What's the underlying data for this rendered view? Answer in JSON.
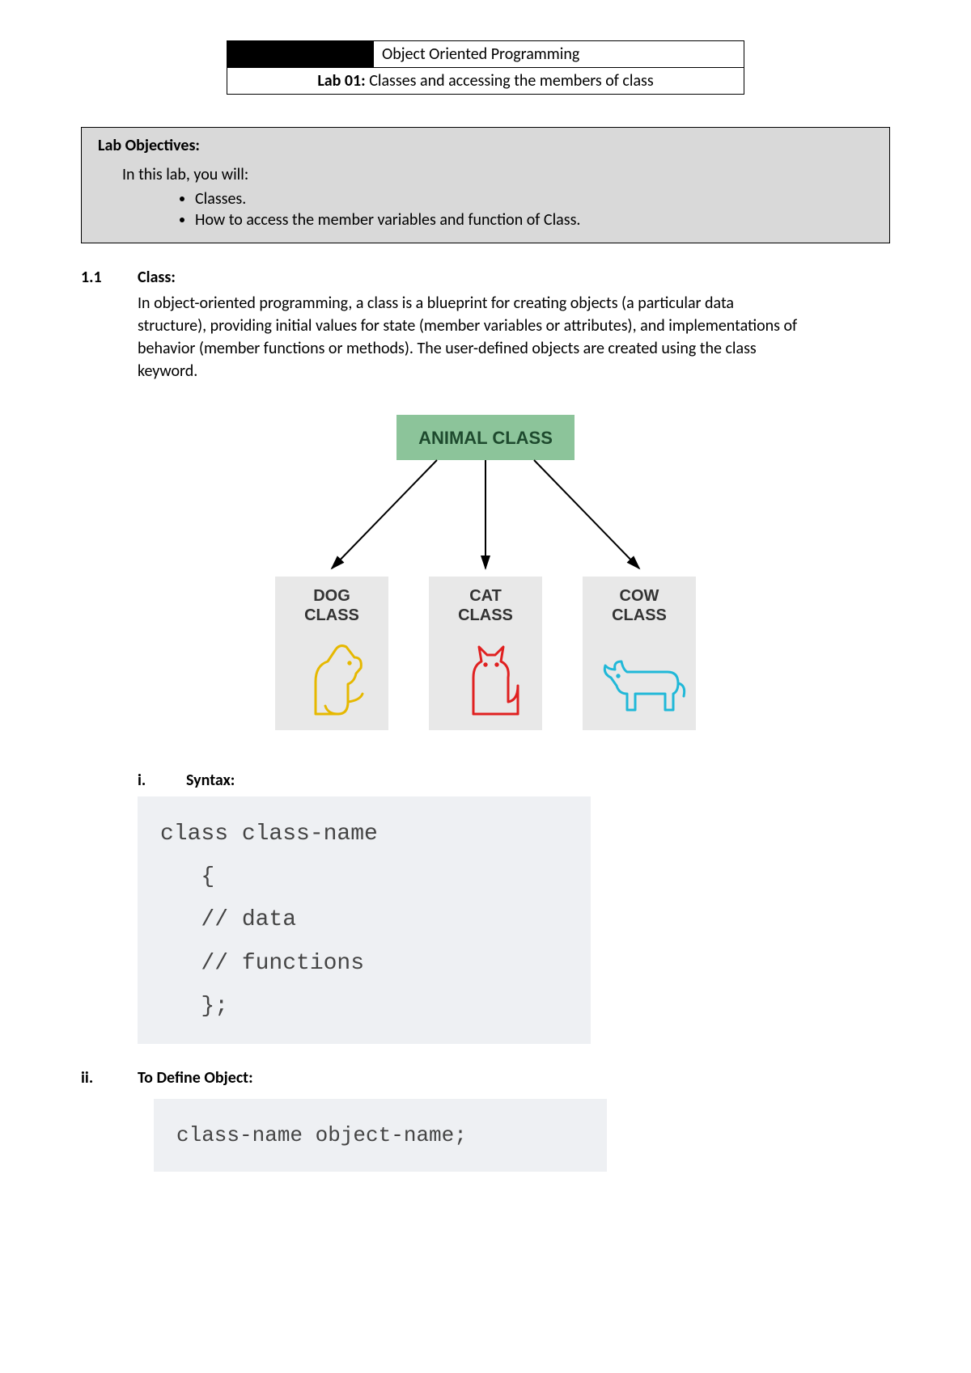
{
  "header": {
    "course_title": "Object Oriented Programming",
    "lab_label": "Lab 01:",
    "lab_title": " Classes and accessing the members of class"
  },
  "objectives": {
    "heading": "Lab Objectives:",
    "intro": "In this lab, you will:",
    "items": [
      "Classes.",
      "How to access the member variables and function of Class."
    ]
  },
  "section1": {
    "number": "1.1",
    "title": "Class:",
    "body": "In object-oriented programming, a class is a blueprint for creating objects (a particular data structure), providing initial values for state (member variables or attributes), and implementations of behavior (member functions or methods). The user-defined objects are created using the class keyword."
  },
  "diagram": {
    "parent": "ANIMAL CLASS",
    "children": [
      {
        "label1": "DOG",
        "label2": "CLASS"
      },
      {
        "label1": "CAT",
        "label2": "CLASS"
      },
      {
        "label1": "COW",
        "label2": "CLASS"
      }
    ]
  },
  "sub_i": {
    "number": "i.",
    "title": "Syntax:",
    "code": "class class-name\n   {\n   // data\n   // functions\n   };"
  },
  "sub_ii": {
    "number": "ii.",
    "title": "To Define Object:",
    "code": "class-name object-name;"
  }
}
